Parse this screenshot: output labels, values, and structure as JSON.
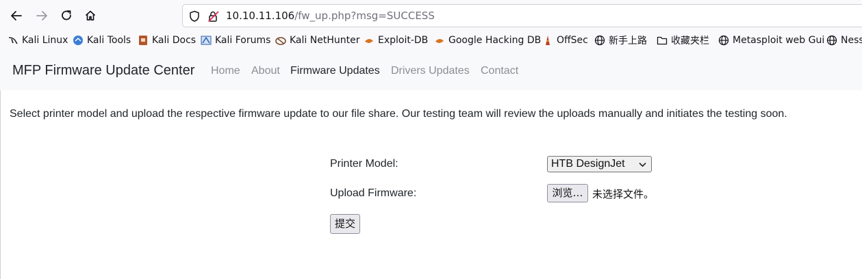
{
  "browser": {
    "url_host": "10.10.11.106",
    "url_path": "/fw_up.php?msg=SUCCESS"
  },
  "bookmarks": [
    {
      "label": "Kali Linux",
      "icon": "kali-dragon-icon"
    },
    {
      "label": "Kali Tools",
      "icon": "kali-tools-icon"
    },
    {
      "label": "Kali Docs",
      "icon": "kali-docs-icon"
    },
    {
      "label": "Kali Forums",
      "icon": "kali-forums-icon"
    },
    {
      "label": "Kali NetHunter",
      "icon": "nethunter-icon"
    },
    {
      "label": "Exploit-DB",
      "icon": "exploit-db-icon"
    },
    {
      "label": "Google Hacking DB",
      "icon": "ghdb-icon"
    },
    {
      "label": "OffSec",
      "icon": "offsec-icon"
    },
    {
      "label": "新手上路",
      "icon": "globe-icon"
    },
    {
      "label": "收藏夹栏",
      "icon": "folder-icon"
    },
    {
      "label": "Metasploit web Gui",
      "icon": "globe-icon"
    },
    {
      "label": "Ness",
      "icon": "globe-icon"
    }
  ],
  "navbar": {
    "brand": "MFP Firmware Update Center",
    "links": [
      "Home",
      "About",
      "Firmware Updates",
      "Drivers Updates",
      "Contact"
    ],
    "active": "Firmware Updates"
  },
  "main": {
    "intro": "Select printer model and upload the respective firmware update to our file share. Our testing team will review the uploads manually and initiates the testing soon.",
    "printer_label": "Printer Model:",
    "printer_value": "HTB DesignJet",
    "upload_label": "Upload Firmware:",
    "browse_label": "浏览…",
    "no_file": "未选择文件。",
    "submit_label": "提交"
  },
  "colors": {
    "navbar_bg": "#f8f9fa",
    "toolbar_bg": "#f9f9fb",
    "link_muted": "#8a8f94",
    "text": "#212529"
  }
}
